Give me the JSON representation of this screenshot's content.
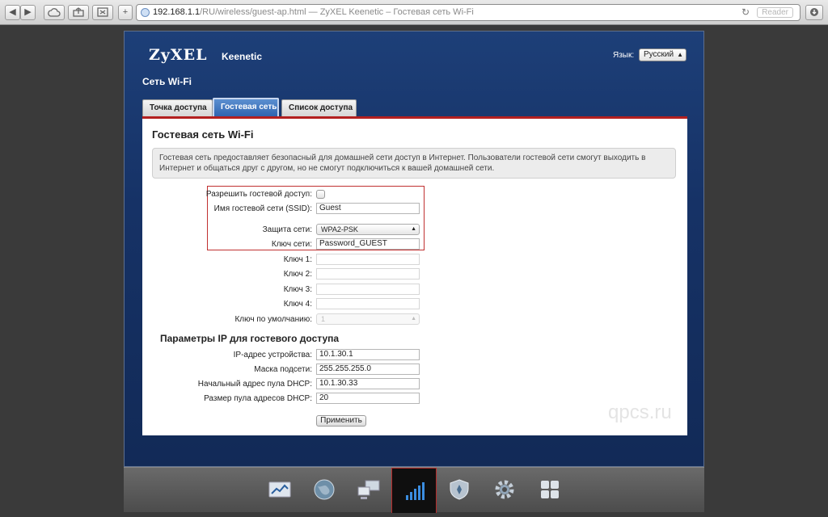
{
  "browser": {
    "url_host": "192.168.1.1",
    "url_path": "/RU/wireless/guest-ap.html",
    "separator": " — ",
    "page_title": "ZyXEL Keenetic – Гостевая сеть Wi-Fi",
    "reader_label": "Reader"
  },
  "header": {
    "logo": "ZyXEL",
    "product": "Keenetic",
    "lang_label": "Язык:",
    "lang_value": "Русский",
    "section": "Сеть Wi-Fi"
  },
  "tabs": [
    {
      "label": "Точка доступа"
    },
    {
      "label": "Гостевая сеть"
    },
    {
      "label": "Список доступа"
    }
  ],
  "content": {
    "title": "Гостевая сеть Wi-Fi",
    "info": "Гостевая сеть предоставляет безопасный для домашней сети доступ в Интернет. Пользователи гостевой сети смогут выходить в Интернет и общаться друг с другом, но не смогут подключиться к вашей домашней сети."
  },
  "form": {
    "allow_label": "Разрешить гостевой доступ:",
    "ssid_label": "Имя гостевой сети (SSID):",
    "ssid_value": "Guest",
    "security_label": "Защита сети:",
    "security_value": "WPA2-PSK",
    "key_label": "Ключ сети:",
    "key_value": "Password_GUEST",
    "key1_label": "Ключ 1:",
    "key2_label": "Ключ 2:",
    "key3_label": "Ключ 3:",
    "key4_label": "Ключ 4:",
    "default_key_label": "Ключ по умолчанию:",
    "default_key_value": "1"
  },
  "ip": {
    "title": "Параметры IP для гостевого доступа",
    "ip_label": "IP-адрес устройства:",
    "ip_value": "10.1.30.1",
    "mask_label": "Маска подсети:",
    "mask_value": "255.255.255.0",
    "pool_start_label": "Начальный адрес пула DHCP:",
    "pool_start_value": "10.1.30.33",
    "pool_size_label": "Размер пула адресов DHCP:",
    "pool_size_value": "20"
  },
  "apply_label": "Применить",
  "watermark": "qpcs.ru",
  "nav_icons": [
    "monitor-icon",
    "internet-icon",
    "home-network-icon",
    "wifi-icon",
    "security-icon",
    "settings-icon",
    "apps-icon"
  ],
  "colors": {
    "accent_red": "#b32020",
    "header_blue": "#163266",
    "tab_active": "#2f64b1"
  }
}
